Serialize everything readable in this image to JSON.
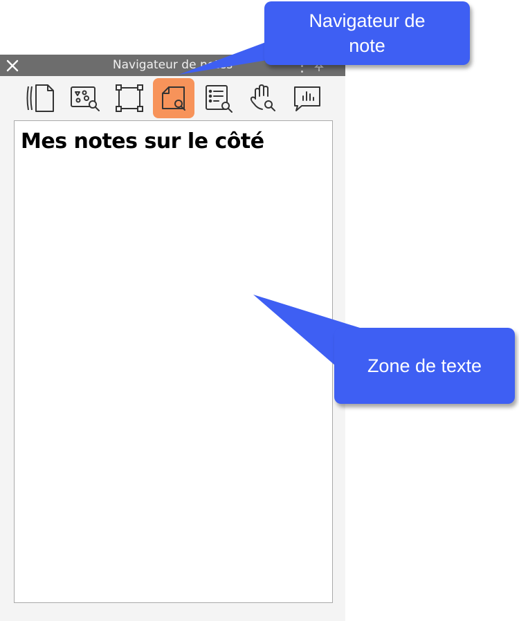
{
  "panel": {
    "title": "Navigateur de notes",
    "close_icon": "close-icon",
    "toolbar": {
      "tools": [
        {
          "name": "page-thumbnails-icon",
          "active": false
        },
        {
          "name": "image-search-icon",
          "active": false
        },
        {
          "name": "frame-select-icon",
          "active": false
        },
        {
          "name": "note-navigator-icon",
          "active": true
        },
        {
          "name": "list-search-icon",
          "active": false
        },
        {
          "name": "hand-search-icon",
          "active": false
        },
        {
          "name": "chart-comment-icon",
          "active": false
        }
      ],
      "active_color": "#f7935a"
    },
    "notes_text": "Mes notes sur le côté"
  },
  "callouts": {
    "navigator": "Navigateur de\nnote",
    "text_zone": "Zone de texte",
    "color": "#3e5ff3"
  }
}
